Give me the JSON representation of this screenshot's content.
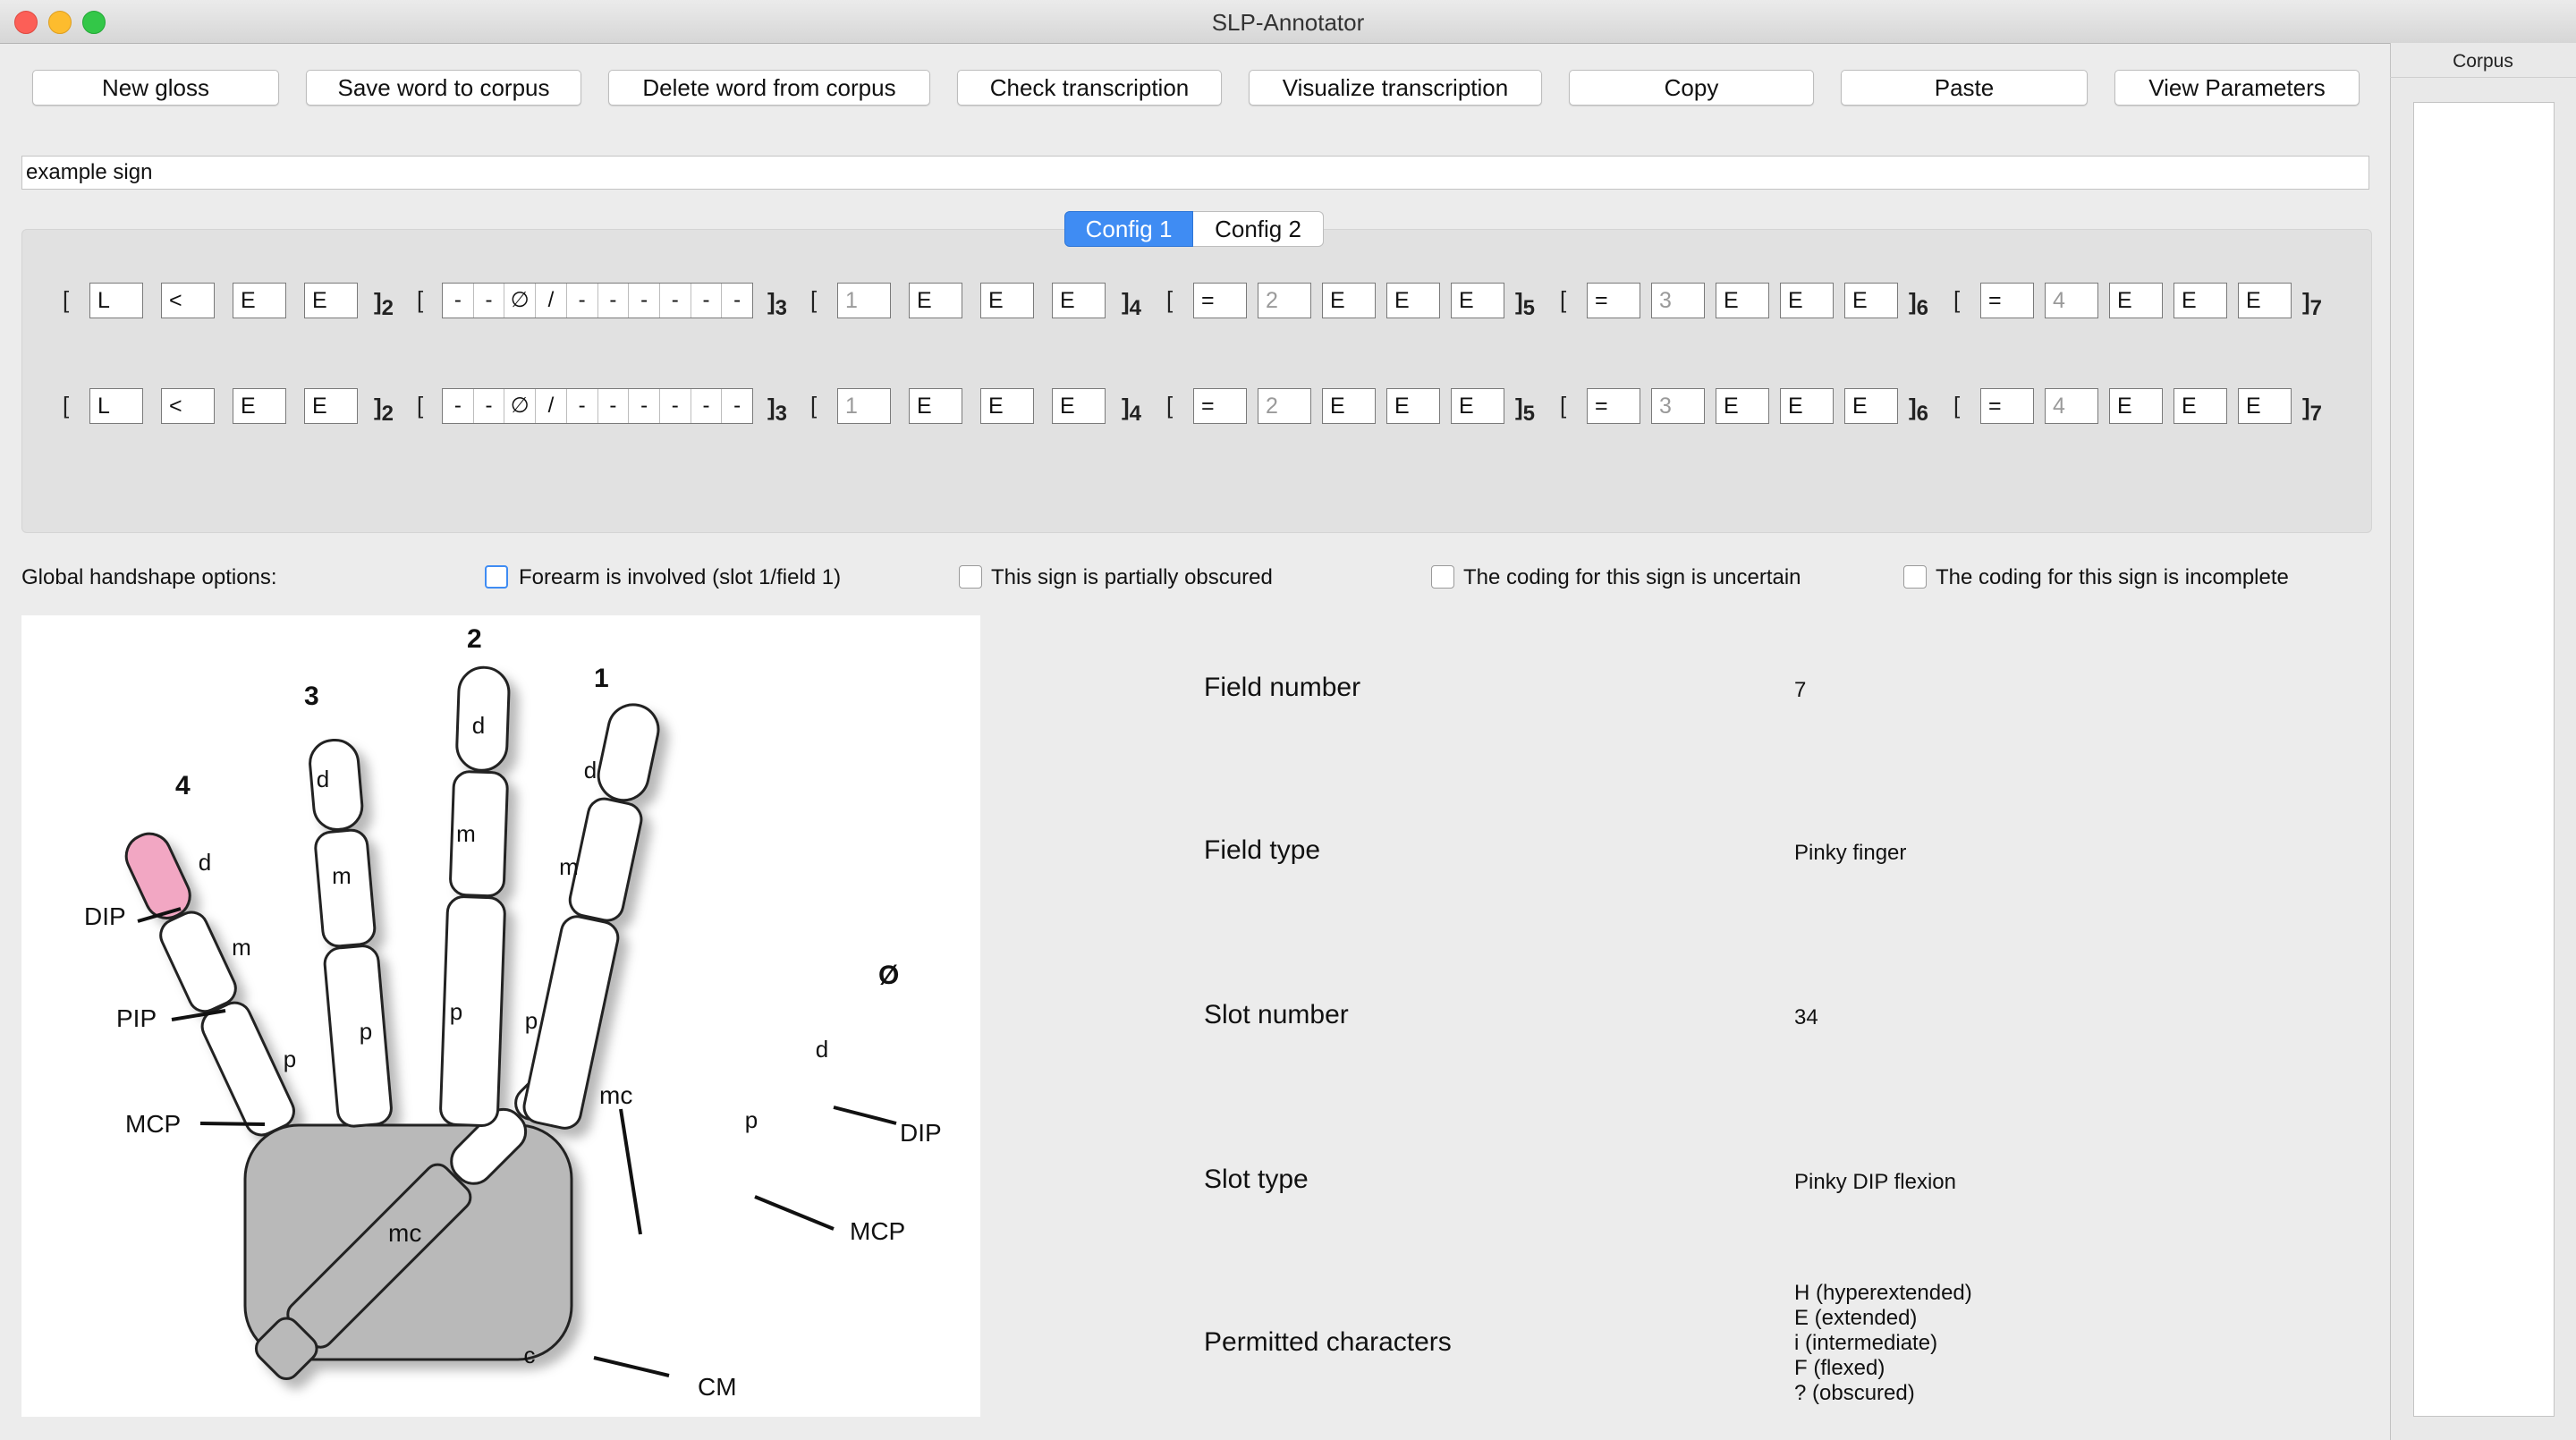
{
  "window": {
    "title": "SLP-Annotator"
  },
  "toolbar": {
    "new_gloss": "New gloss",
    "save_word": "Save word to corpus",
    "delete_word": "Delete word from corpus",
    "check": "Check transcription",
    "visualize": "Visualize transcription",
    "copy": "Copy",
    "paste": "Paste",
    "view_params": "View Parameters"
  },
  "gloss": {
    "value": "example sign"
  },
  "tabs": [
    "Config 1",
    "Config 2"
  ],
  "config_rows": [
    {
      "f2": [
        "L",
        "<",
        "E",
        "E"
      ],
      "f3": [
        "-",
        "-",
        "∅",
        "/",
        "-",
        "-",
        "-",
        "-",
        "-",
        "-"
      ],
      "f4": [
        "1",
        "E",
        "E",
        "E"
      ],
      "f5": [
        "=",
        "2",
        "E",
        "E",
        "E"
      ],
      "f6": [
        "=",
        "3",
        "E",
        "E",
        "E"
      ],
      "f7": [
        "=",
        "4",
        "E",
        "E",
        "E"
      ]
    },
    {
      "f2": [
        "L",
        "<",
        "E",
        "E"
      ],
      "f3": [
        "-",
        "-",
        "∅",
        "/",
        "-",
        "-",
        "-",
        "-",
        "-",
        "-"
      ],
      "f4": [
        "1",
        "E",
        "E",
        "E"
      ],
      "f5": [
        "=",
        "2",
        "E",
        "E",
        "E"
      ],
      "f6": [
        "=",
        "3",
        "E",
        "E",
        "E"
      ],
      "f7": [
        "=",
        "4",
        "E",
        "E",
        "E"
      ]
    }
  ],
  "brackets": {
    "open": "[",
    "close": "]",
    "fields": [
      "2",
      "3",
      "4",
      "5",
      "6",
      "7"
    ]
  },
  "options": {
    "label": "Global handshape options:",
    "forearm": "Forearm is involved (slot 1/field 1)",
    "obscured": "This sign is partially obscured",
    "uncertain": "The coding for this sign is uncertain",
    "incomplete": "The coding for this sign is incomplete"
  },
  "hand_diagram": {
    "finger_numbers": [
      "1",
      "2",
      "3",
      "4",
      "Ø"
    ],
    "segments": [
      "d",
      "m",
      "p",
      "mc",
      "c"
    ],
    "joints": [
      "DIP",
      "PIP",
      "MCP",
      "CM"
    ],
    "highlight_color": "#f2a7c3"
  },
  "info": {
    "field_number_label": "Field number",
    "field_number_value": "7",
    "field_type_label": "Field type",
    "field_type_value": "Pinky finger",
    "slot_number_label": "Slot number",
    "slot_number_value": "34",
    "slot_type_label": "Slot type",
    "slot_type_value": "Pinky DIP flexion",
    "permitted_label": "Permitted characters",
    "permitted": [
      "H (hyperextended)",
      "E (extended)",
      "i (intermediate)",
      "F (flexed)",
      "? (obscured)"
    ]
  },
  "corpus": {
    "header": "Corpus"
  },
  "colors": {
    "accent": "#3f8cf3",
    "window_bg": "#ececec"
  }
}
